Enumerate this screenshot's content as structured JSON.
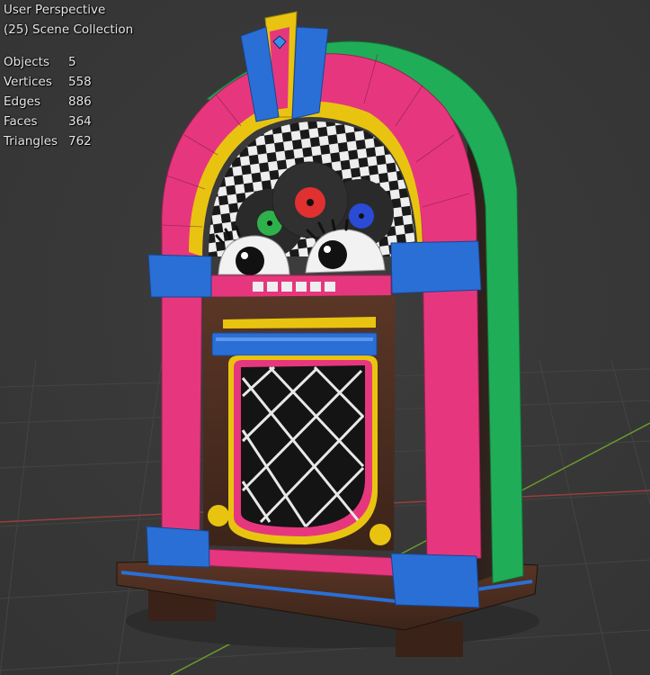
{
  "header": {
    "view_name": "User Perspective",
    "collection": "(25) Scene Collection"
  },
  "stats": [
    {
      "label": "Objects",
      "value": "5"
    },
    {
      "label": "Vertices",
      "value": "558"
    },
    {
      "label": "Edges",
      "value": "886"
    },
    {
      "label": "Faces",
      "value": "364"
    },
    {
      "label": "Triangles",
      "value": "762"
    }
  ],
  "colors": {
    "viewport_bg": "#393939",
    "grid_line": "#434343",
    "x_axis": "#9a3d3d",
    "y_axis": "#6b9a2e",
    "body_pink": "#e6377e",
    "trim_green": "#1fae57",
    "trim_yellow": "#e8c411",
    "trim_blue": "#2a6fd6",
    "wood": "#4a2c20",
    "record_red": "#e03030",
    "record_green": "#2eb04a",
    "record_blue": "#2a4bd6"
  }
}
